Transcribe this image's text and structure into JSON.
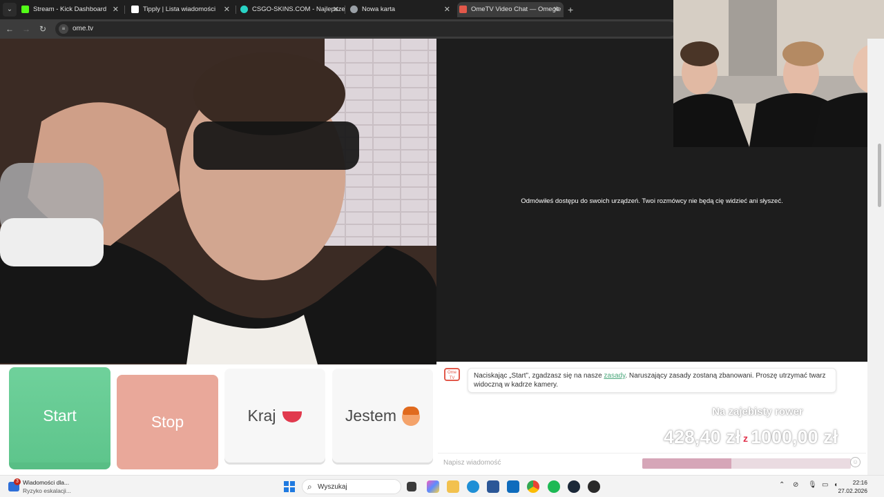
{
  "browser": {
    "tabs": [
      {
        "title": "Stream - Kick Dashboard",
        "favicon_color": "#53fc18",
        "active": false
      },
      {
        "title": "Tipply | Lista wiadomości",
        "favicon_color": "#ffffff",
        "active": false
      },
      {
        "title": "CSGO-SKINS.COM - Najlepsze",
        "favicon_color": "#29d3c5",
        "active": false
      },
      {
        "title": "Nowa karta",
        "favicon_color": "#9aa0a6",
        "active": false
      },
      {
        "title": "OmeTV Video Chat — Omegle",
        "favicon_color": "#e2584a",
        "active": true
      }
    ],
    "url": "ome.tv"
  },
  "main": {
    "notice": "Odmówiłeś dostępu do swoich urządzeń. Twoi rozmówcy nie będą cię widzieć ani słyszeć."
  },
  "controls": {
    "start": "Start",
    "stop": "Stop",
    "country": "Kraj",
    "gender": "Jestem"
  },
  "chat": {
    "logo_text": "Ome TV",
    "rules_before": "Naciskając „Start”, zgadzasz się na nasze ",
    "rules_link": "zasady",
    "rules_after": ". Naruszający zasady zostaną zbanowani. Proszę utrzymać twarz widoczną w kadrze kamery.",
    "input_placeholder": "Napisz wiadomość"
  },
  "donation_goal": {
    "title": "Na zajebisty rower",
    "current": "428,40 zł",
    "separator": "z",
    "target": "1000,00 zł",
    "progress_fraction": 0.4284
  },
  "taskbar": {
    "notification_count": "3",
    "notification_title": "Wiadomości dla...",
    "notification_subtitle": "Ryzyko eskalacji...",
    "search_placeholder": "Wyszukaj",
    "time": "22:16",
    "date": "27.02.2026"
  }
}
